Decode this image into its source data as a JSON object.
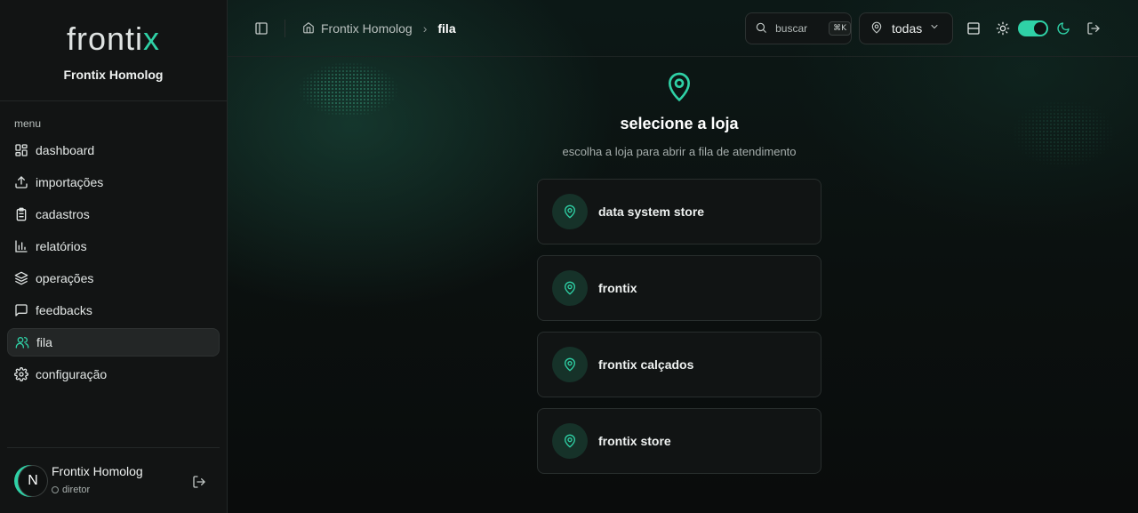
{
  "brand": {
    "logo_main": "fronti",
    "logo_accent": "x",
    "subtitle": "Frontix Homolog"
  },
  "sidebar": {
    "menu_label": "menu",
    "items": [
      {
        "label": "dashboard",
        "icon": "dashboard-icon"
      },
      {
        "label": "importações",
        "icon": "upload-icon"
      },
      {
        "label": "cadastros",
        "icon": "clipboard-icon"
      },
      {
        "label": "relatórios",
        "icon": "bar-chart-icon"
      },
      {
        "label": "operações",
        "icon": "layers-icon"
      },
      {
        "label": "feedbacks",
        "icon": "message-icon"
      },
      {
        "label": "fila",
        "icon": "users-icon",
        "active": true
      },
      {
        "label": "configuração",
        "icon": "gear-icon"
      }
    ]
  },
  "user": {
    "initial": "N",
    "name": "Frontix Homolog",
    "role": "diretor"
  },
  "header": {
    "breadcrumb_home": "Frontix Homolog",
    "breadcrumb_current": "fila",
    "search_placeholder": "buscar",
    "search_shortcut": "⌘K",
    "store_filter": "todas"
  },
  "content": {
    "title": "selecione a loja",
    "subtitle": "escolha a loja para abrir a fila de atendimento",
    "stores": [
      {
        "name": "data system store"
      },
      {
        "name": "frontix"
      },
      {
        "name": "frontix calçados"
      },
      {
        "name": "frontix store"
      }
    ]
  },
  "colors": {
    "accent": "#2fd1a6",
    "background": "#0a0d0c",
    "sidebar": "#121414"
  }
}
